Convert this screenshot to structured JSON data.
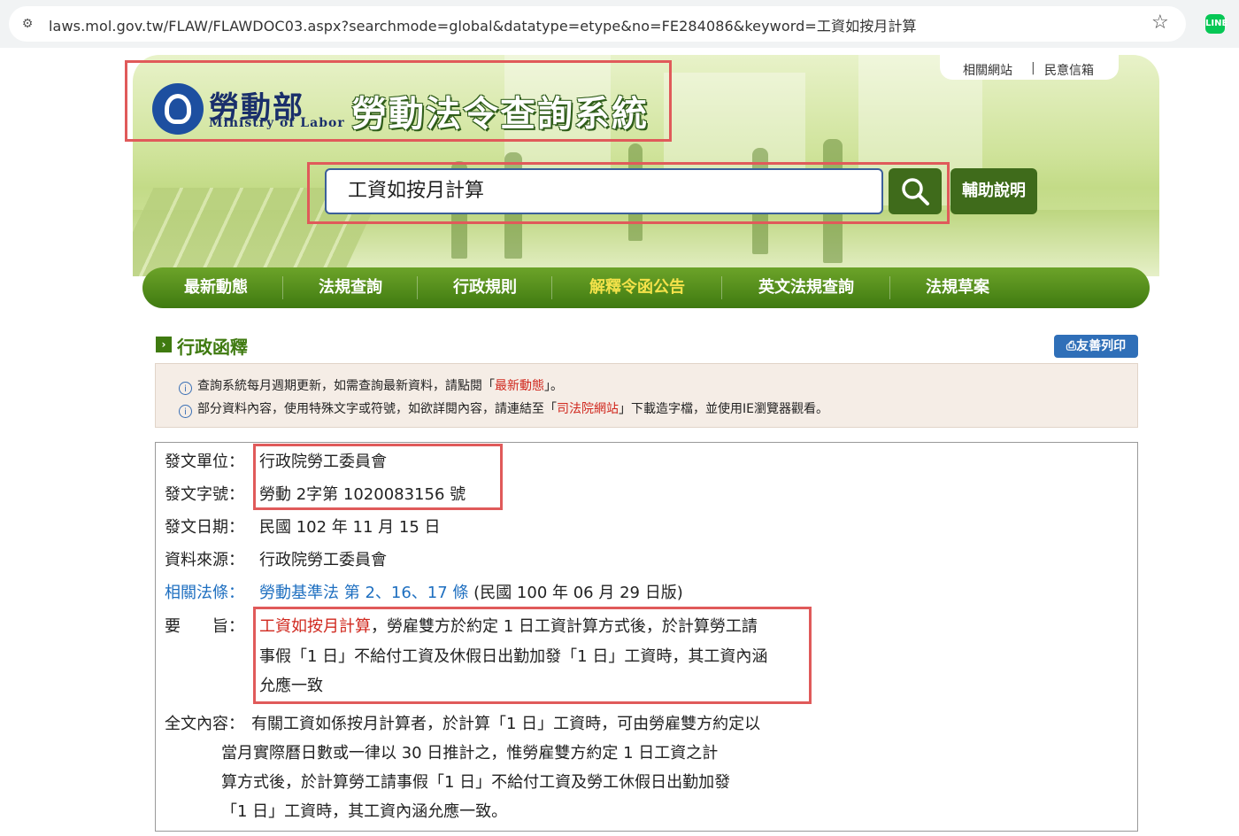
{
  "browser": {
    "url": "laws.mol.gov.tw/FLAW/FLAWDOC03.aspx?searchmode=global&datatype=etype&no=FE284086&keyword=工資如按月計算",
    "extension_label": "LINE"
  },
  "header": {
    "top_links": [
      "相關網站",
      "民意信箱"
    ],
    "logo_cn": "勞動部",
    "logo_en": "Ministry of Labor",
    "site_title": "勞動法令查詢系統",
    "search_value": "工資如按月計算",
    "help_label": "輔助說明"
  },
  "nav": {
    "items": [
      "最新動態",
      "法規查詢",
      "行政規則",
      "解釋令函公告",
      "英文法規查詢",
      "法規草案"
    ],
    "active_index": 3
  },
  "section": {
    "title": "行政函釋",
    "print_label": "友善列印"
  },
  "notice": {
    "line1_a": "查詢系統每月週期更新，如需查詢最新資料，請點閱「",
    "line1_link": "最新動態",
    "line1_b": "」。",
    "line2_a": "部分資料內容，使用特殊文字或符號，如欲詳閱內容，請連結至「",
    "line2_link": "司法院網站",
    "line2_b": "」下載造字檔，並使用IE瀏覽器觀看。"
  },
  "doc": {
    "issuer_label": "發文單位：",
    "issuer": "行政院勞工委員會",
    "number_label": "發文字號：",
    "number": "勞動 2字第 1020083156 號",
    "date_label": "發文日期：",
    "date": "民國 102 年 11 月 15 日",
    "source_label": "資料來源：",
    "source": "行政院勞工委員會",
    "law_label": "相關法條：",
    "law_link": "勞動基準法 第 2、16、17 條",
    "law_version": "(民國 100 年 06 月 29 日版)",
    "summary_label": "要　　旨：",
    "summary_keyword": "工資如按月計算",
    "summary_line1": "，勞雇雙方於約定 1 日工資計算方式後，於計算勞工請",
    "summary_line2": "事假「1 日」不給付工資及休假日出勤加發「1 日」工資時，其工資內涵",
    "summary_line3": "允應一致",
    "full_label": "全文內容：",
    "full_line1": "有關工資如係按月計算者，於計算「1 日」工資時，可由勞雇雙方約定以",
    "full_line2": "當月實際曆日數或一律以 30 日推計之，惟勞雇雙方約定 1 日工資之計",
    "full_line3": "算方式後，於計算勞工請事假「1 日」不給付工資及勞工休假日出勤加發",
    "full_line4": "「1 日」工資時，其工資內涵允應一致。"
  },
  "colors": {
    "nav_green": "#3f7a10",
    "nav_active": "#f4e24a",
    "highlight_red": "#e05a5a",
    "link_blue": "#1e6fc0",
    "keyword_red": "#d0281e"
  }
}
